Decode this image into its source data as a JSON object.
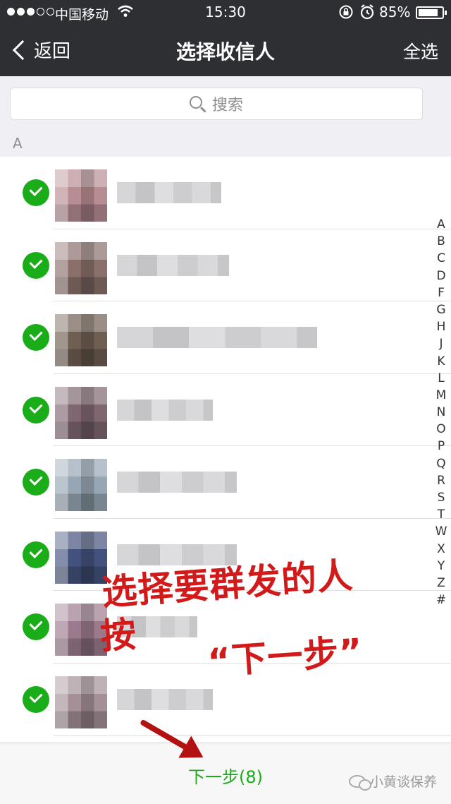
{
  "status_bar": {
    "carrier": "中国移动",
    "time": "15:30",
    "battery_percent": "85%",
    "battery_level": 0.85,
    "signal_bars": 3,
    "signal_total": 5
  },
  "nav": {
    "back_label": "返回",
    "title": "选择收信人",
    "select_all_label": "全选"
  },
  "search": {
    "placeholder": "搜索"
  },
  "section": {
    "letter": "A"
  },
  "contacts": [
    {
      "selected": true,
      "avatar_color": "#b88c93",
      "name_width": 0.52
    },
    {
      "selected": true,
      "avatar_color": "#8a6f6a",
      "name_width": 0.56
    },
    {
      "selected": true,
      "avatar_color": "#6f5e52",
      "name_width": 1.0
    },
    {
      "selected": true,
      "avatar_color": "#7f6670",
      "name_width": 0.48
    },
    {
      "selected": true,
      "avatar_color": "#97a6b4",
      "name_width": 0.6
    },
    {
      "selected": true,
      "avatar_color": "#43527c",
      "name_width": 0.6
    },
    {
      "selected": true,
      "avatar_color": "#9c7a8e",
      "name_width": 0.4
    },
    {
      "selected": true,
      "avatar_color": "#a49096",
      "name_width": 0.48
    }
  ],
  "alpha_index": [
    "A",
    "B",
    "C",
    "D",
    "F",
    "G",
    "H",
    "J",
    "K",
    "L",
    "M",
    "N",
    "O",
    "P",
    "Q",
    "R",
    "S",
    "T",
    "W",
    "X",
    "Y",
    "Z",
    "#"
  ],
  "annotation": {
    "line1": "选择要群发的人",
    "line2": "按",
    "line3": "“下一步”"
  },
  "bottom": {
    "next_label": "下一步(8)",
    "watermark": "小黄谈保养"
  }
}
